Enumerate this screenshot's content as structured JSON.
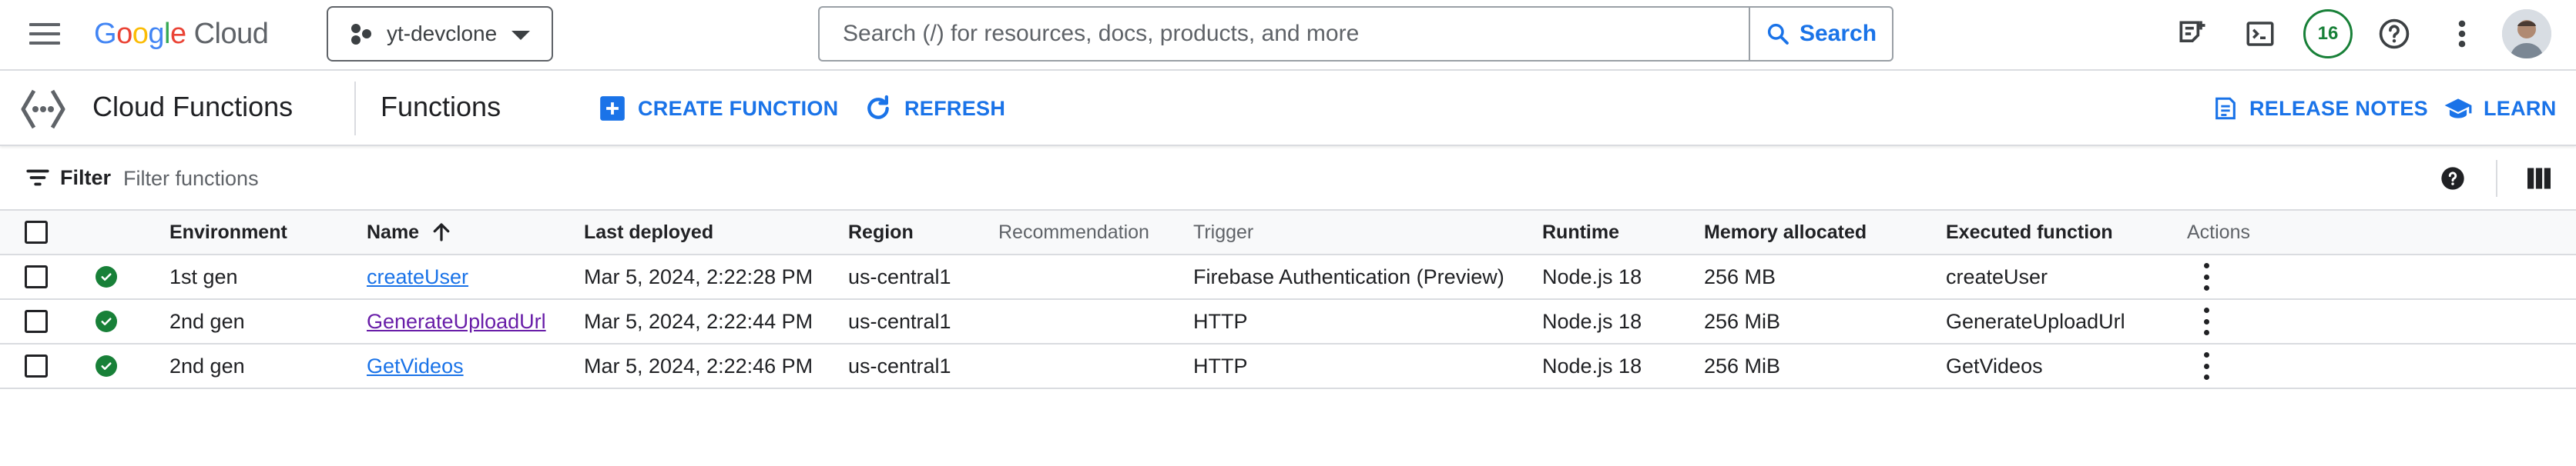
{
  "topbar": {
    "logo": {
      "google": [
        "G",
        "o",
        "o",
        "g",
        "l",
        "e"
      ],
      "cloud": "Cloud"
    },
    "project": "yt-devclone",
    "search": {
      "placeholder": "Search (/) for resources, docs, products, and more",
      "button": "Search"
    },
    "notifications_count": "16",
    "icons": [
      "menu-icon",
      "notes-icon",
      "terminal-icon",
      "help-icon",
      "more-vert-icon"
    ]
  },
  "subbar": {
    "product": "Cloud Functions",
    "page_title": "Functions",
    "create_label": "CREATE FUNCTION",
    "refresh_label": "REFRESH",
    "release_notes_label": "RELEASE NOTES",
    "learn_label": "LEARN"
  },
  "filterbar": {
    "label": "Filter",
    "placeholder": "Filter functions"
  },
  "table": {
    "headers": {
      "environment": "Environment",
      "name": "Name",
      "last_deployed": "Last deployed",
      "region": "Region",
      "recommendation": "Recommendation",
      "trigger": "Trigger",
      "runtime": "Runtime",
      "memory": "Memory allocated",
      "executed": "Executed function",
      "actions": "Actions"
    },
    "rows": [
      {
        "environment": "1st gen",
        "name": "createUser",
        "last_deployed": "Mar 5, 2024, 2:22:28 PM",
        "region": "us-central1",
        "recommendation": "",
        "trigger": "Firebase Authentication (Preview)",
        "runtime": "Node.js 18",
        "memory": "256 MB",
        "executed": "createUser"
      },
      {
        "environment": "2nd gen",
        "name": "GenerateUploadUrl",
        "last_deployed": "Mar 5, 2024, 2:22:44 PM",
        "region": "us-central1",
        "recommendation": "",
        "trigger": "HTTP",
        "runtime": "Node.js 18",
        "memory": "256 MiB",
        "executed": "GenerateUploadUrl"
      },
      {
        "environment": "2nd gen",
        "name": "GetVideos",
        "last_deployed": "Mar 5, 2024, 2:22:46 PM",
        "region": "us-central1",
        "recommendation": "",
        "trigger": "HTTP",
        "runtime": "Node.js 18",
        "memory": "256 MiB",
        "executed": "GetVideos"
      }
    ]
  },
  "colors": {
    "accent": "#1a73e8",
    "success": "#188038",
    "visited_link": "#681da8",
    "border": "#dadce0",
    "header_bg": "#f8f9fa"
  }
}
